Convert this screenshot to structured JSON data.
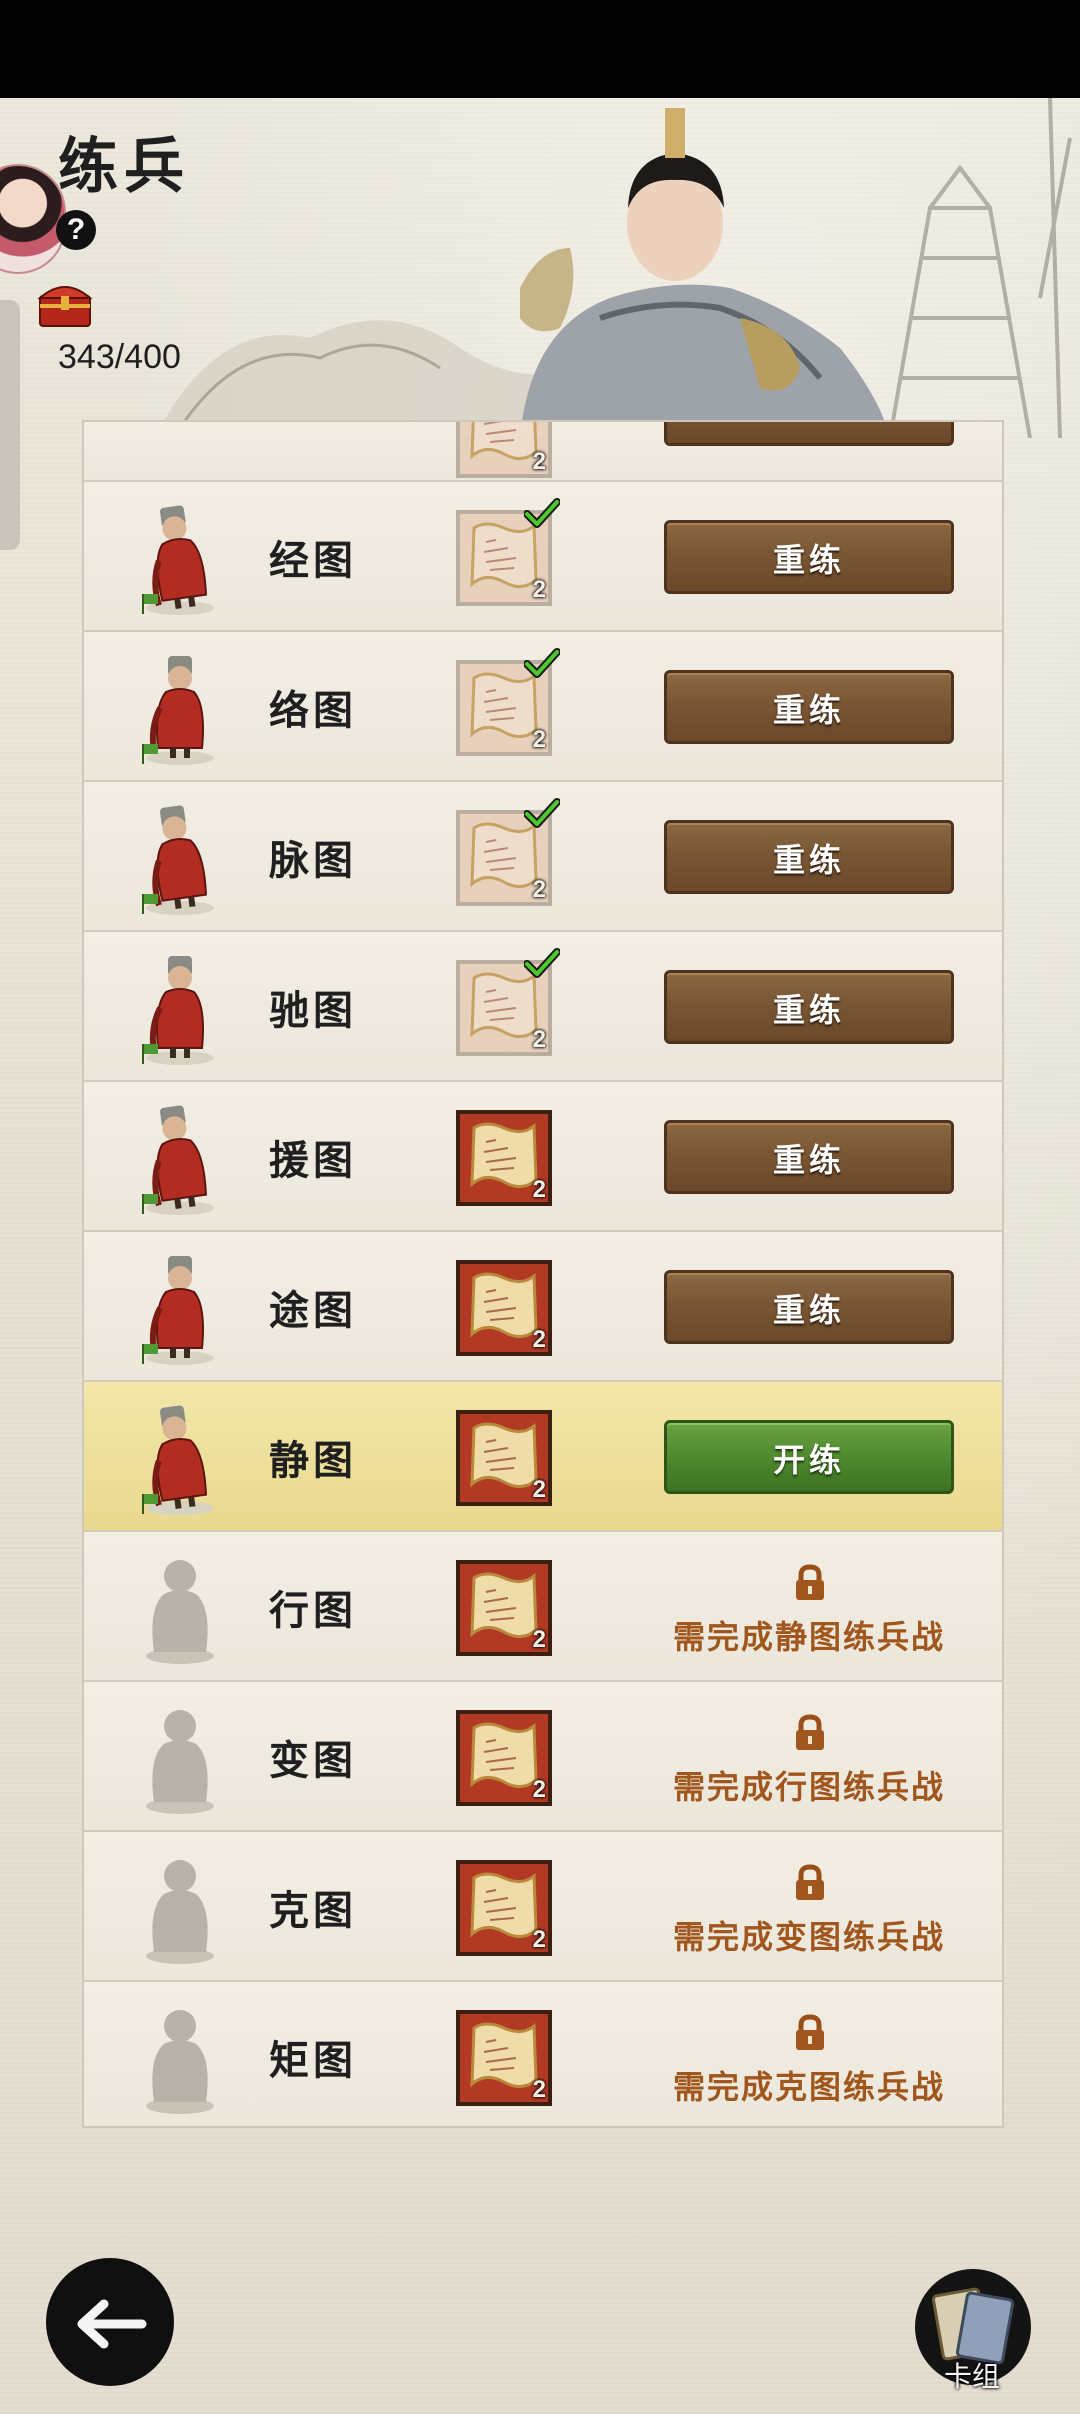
{
  "header": {
    "title": "练兵",
    "help_label": "?",
    "chest_count": "343/400"
  },
  "rows": [
    {
      "name": "经图",
      "scroll_count": "2",
      "completed": true,
      "action": "重练"
    },
    {
      "name": "络图",
      "scroll_count": "2",
      "completed": true,
      "action": "重练"
    },
    {
      "name": "脉图",
      "scroll_count": "2",
      "completed": true,
      "action": "重练"
    },
    {
      "name": "驰图",
      "scroll_count": "2",
      "completed": true,
      "action": "重练"
    },
    {
      "name": "援图",
      "scroll_count": "2",
      "completed": false,
      "action": "重练"
    },
    {
      "name": "途图",
      "scroll_count": "2",
      "completed": false,
      "action": "重练"
    },
    {
      "name": "静图",
      "scroll_count": "2",
      "completed": false,
      "action": "开练"
    },
    {
      "name": "行图",
      "scroll_count": "2",
      "completed": false,
      "locked_text": "需完成静图练兵战"
    },
    {
      "name": "变图",
      "scroll_count": "2",
      "completed": false,
      "locked_text": "需完成行图练兵战"
    },
    {
      "name": "克图",
      "scroll_count": "2",
      "completed": false,
      "locked_text": "需完成变图练兵战"
    },
    {
      "name": "矩图",
      "scroll_count": "2",
      "completed": false,
      "locked_text": "需完成克图练兵战"
    }
  ],
  "top_partial_row": {
    "scroll_count": "2"
  },
  "footer": {
    "deck_label": "卡组"
  },
  "colors": {
    "button_brown": "#7a5634",
    "button_green": "#4f8a2f",
    "highlight_row": "#efe19c",
    "lock_text": "#a0561c"
  }
}
